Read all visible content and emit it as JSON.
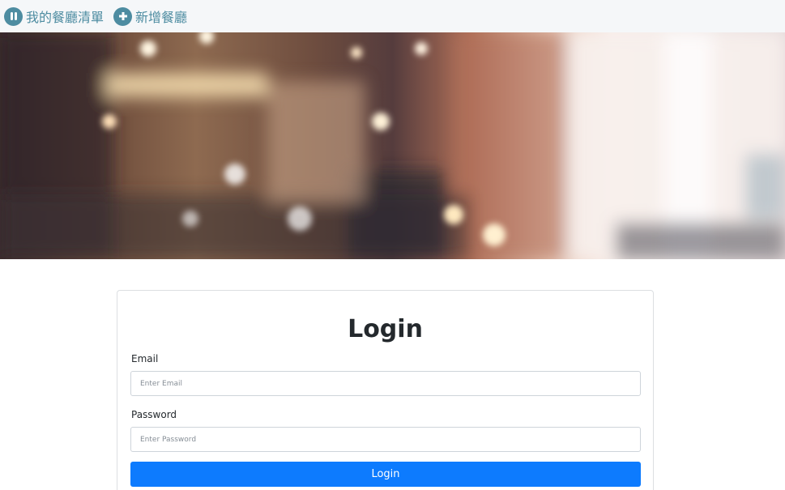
{
  "navbar": {
    "links": [
      {
        "label": "我的餐廳清單",
        "icon": "utensils-icon"
      },
      {
        "label": "新增餐廳",
        "icon": "plus-circle-icon"
      }
    ]
  },
  "colors": {
    "nav_accent": "#4d8ca1",
    "primary_button": "#0d7bfe"
  },
  "login_form": {
    "title": "Login",
    "email_label": "Email",
    "email_placeholder": "Enter Email",
    "email_value": "",
    "password_label": "Password",
    "password_placeholder": "Enter Password",
    "password_value": "",
    "submit_label": "Login"
  }
}
